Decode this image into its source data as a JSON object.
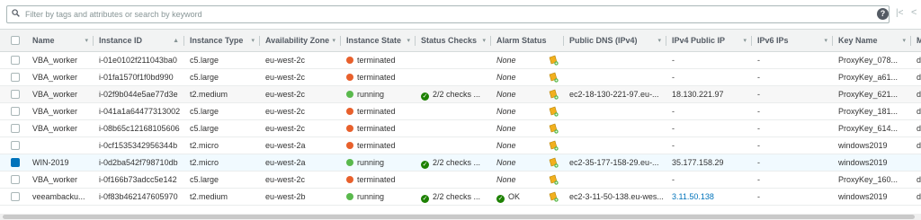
{
  "search": {
    "placeholder": "Filter by tags and attributes or search by keyword"
  },
  "colors": {
    "terminated": "#e8602c",
    "running": "#5ab94d",
    "selected_row": "#f1faff",
    "link": "#0073bb"
  },
  "icons": {
    "search": "search-icon",
    "help": "help-icon",
    "first_page": "first-page-icon",
    "prev_page": "prev-page-icon",
    "alarm": "alarm-bell-icon"
  },
  "columns": [
    {
      "label": "Name",
      "sort": "▾"
    },
    {
      "label": "Instance ID",
      "sort": "▲"
    },
    {
      "label": "Instance Type",
      "sort": "▾"
    },
    {
      "label": "Availability Zone",
      "sort": "▾"
    },
    {
      "label": "Instance State",
      "sort": "▾"
    },
    {
      "label": "Status Checks",
      "sort": "▾"
    },
    {
      "label": "Alarm Status",
      "sort": ""
    },
    {
      "label": "Public DNS (IPv4)",
      "sort": "▾"
    },
    {
      "label": "IPv4 Public IP",
      "sort": "▾"
    },
    {
      "label": "IPv6 IPs",
      "sort": "▾"
    },
    {
      "label": "Key Name",
      "sort": "▾"
    },
    {
      "label": "M",
      "sort": ""
    }
  ],
  "rows": [
    {
      "name": "VBA_worker",
      "id": "i-01e0102f211043ba0",
      "type": "c5.large",
      "az": "eu-west-2c",
      "state": "terminated",
      "checks": "",
      "alarm": "None",
      "dns": "",
      "ip": "-",
      "ipv6": "-",
      "key": "ProxyKey_078...",
      "m": "dis",
      "selected": false
    },
    {
      "name": "VBA_worker",
      "id": "i-01fa1570f1f0bd990",
      "type": "c5.large",
      "az": "eu-west-2c",
      "state": "terminated",
      "checks": "",
      "alarm": "None",
      "dns": "",
      "ip": "-",
      "ipv6": "-",
      "key": "ProxyKey_a61...",
      "m": "dis",
      "selected": false
    },
    {
      "name": "VBA_worker",
      "id": "i-02f9b044e5ae77d3e",
      "type": "t2.medium",
      "az": "eu-west-2c",
      "state": "running",
      "checks": "2/2 checks ...",
      "alarm": "None",
      "dns": "ec2-18-130-221-97.eu-...",
      "ip": "18.130.221.97",
      "ipv6": "-",
      "key": "ProxyKey_621...",
      "m": "dis",
      "selected": false,
      "hover": true
    },
    {
      "name": "VBA_worker",
      "id": "i-041a1a64477313002",
      "type": "c5.large",
      "az": "eu-west-2c",
      "state": "terminated",
      "checks": "",
      "alarm": "None",
      "dns": "",
      "ip": "-",
      "ipv6": "-",
      "key": "ProxyKey_181...",
      "m": "dis",
      "selected": false
    },
    {
      "name": "VBA_worker",
      "id": "i-08b65c12168105606",
      "type": "c5.large",
      "az": "eu-west-2c",
      "state": "terminated",
      "checks": "",
      "alarm": "None",
      "dns": "",
      "ip": "-",
      "ipv6": "-",
      "key": "ProxyKey_614...",
      "m": "dis",
      "selected": false
    },
    {
      "name": "",
      "id": "i-0cf1535342956344b",
      "type": "t2.micro",
      "az": "eu-west-2a",
      "state": "terminated",
      "checks": "",
      "alarm": "None",
      "dns": "",
      "ip": "-",
      "ipv6": "-",
      "key": "windows2019",
      "m": "dis",
      "selected": false
    },
    {
      "name": "WIN-2019",
      "id": "i-0d2ba542f798710db",
      "type": "t2.micro",
      "az": "eu-west-2a",
      "state": "running",
      "checks": "2/2 checks ...",
      "alarm": "None",
      "dns": "ec2-35-177-158-29.eu-...",
      "ip": "35.177.158.29",
      "ipv6": "-",
      "key": "windows2019",
      "m": "",
      "selected": true
    },
    {
      "name": "VBA_worker",
      "id": "i-0f166b73adcc5e142",
      "type": "c5.large",
      "az": "eu-west-2c",
      "state": "terminated",
      "checks": "",
      "alarm": "None",
      "dns": "",
      "ip": "-",
      "ipv6": "-",
      "key": "ProxyKey_160...",
      "m": "dis",
      "selected": false
    },
    {
      "name": "veeambacku...",
      "id": "i-0f83b462147605970",
      "type": "t2.medium",
      "az": "eu-west-2b",
      "state": "running",
      "checks": "2/2 checks ...",
      "alarm": "OK",
      "dns": "ec2-3-11-50-138.eu-wes...",
      "ip": "3.11.50.138",
      "ipv6": "-",
      "key": "windows2019",
      "m": "dis",
      "selected": false,
      "ip_link": true
    }
  ]
}
